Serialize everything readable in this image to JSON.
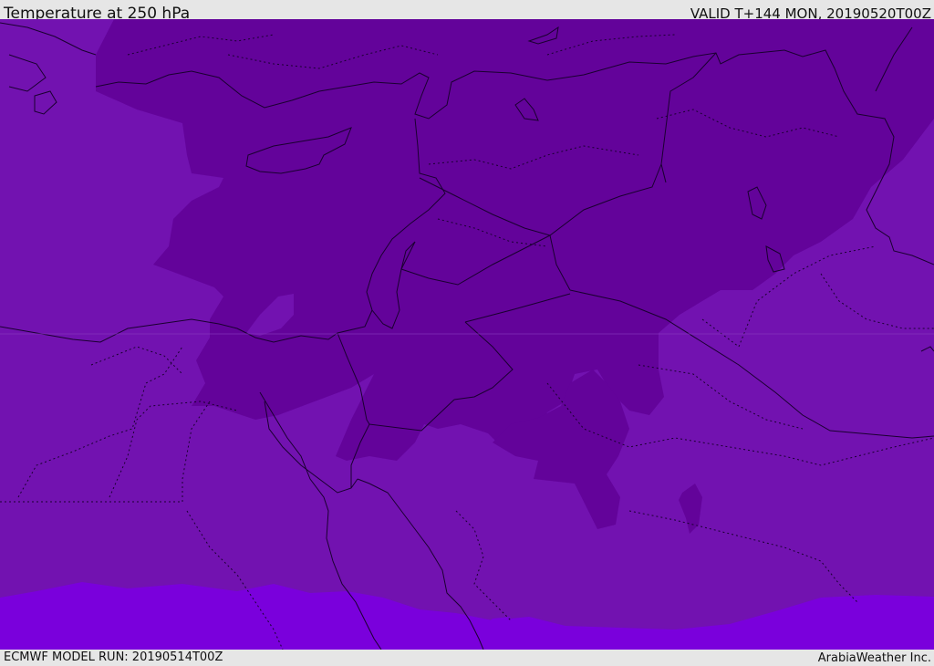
{
  "header": {
    "title": "Temperature at 250 hPa",
    "valid_time": "VALID T+144 MON, 20190520T00Z"
  },
  "footer": {
    "model_run": "ECMWF MODEL RUN: 20190514T00Z",
    "credit": "ArabiaWeather Inc."
  },
  "map": {
    "variable": "temperature",
    "pressure_level_hpa": 250,
    "colors": {
      "cold_zone": "#63039a",
      "mid_zone": "#7212b0",
      "warm_zone": "#7a00dc",
      "coastline": "#1a0030",
      "border": "#1a0030"
    }
  }
}
